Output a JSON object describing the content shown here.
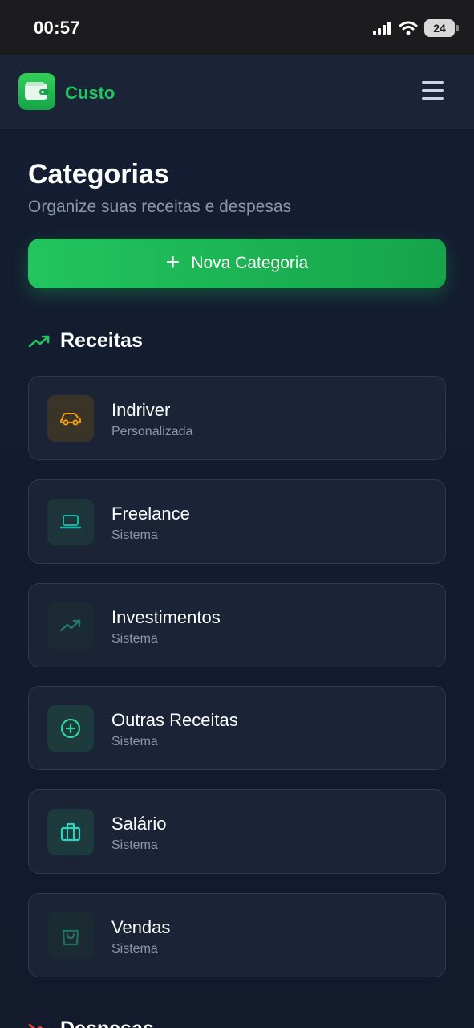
{
  "status_bar": {
    "time": "00:57",
    "battery": "24",
    "icons": [
      "signal-icon",
      "wifi-icon",
      "battery-icon"
    ]
  },
  "header": {
    "brand": "Custo",
    "logo_icon": "wallet-icon",
    "menu_icon": "hamburger-menu-icon"
  },
  "page": {
    "title": "Categorias",
    "subtitle": "Organize suas receitas e despesas",
    "new_button_label": "Nova Categoria"
  },
  "colors": {
    "accent_green": "#22c55e",
    "income_trend": "#22c55e",
    "expense_trend": "#ef4444",
    "car_orange": "#f59e0b"
  },
  "sections": {
    "income": {
      "title": "Receitas",
      "icon": "trending-up-icon",
      "items": [
        {
          "name": "Indriver",
          "type": "Personalizada",
          "icon": "car-icon"
        },
        {
          "name": "Freelance",
          "type": "Sistema",
          "icon": "laptop-icon"
        },
        {
          "name": "Investimentos",
          "type": "Sistema",
          "icon": "trending-up-icon"
        },
        {
          "name": "Outras Receitas",
          "type": "Sistema",
          "icon": "plus-circle-icon"
        },
        {
          "name": "Salário",
          "type": "Sistema",
          "icon": "briefcase-icon"
        },
        {
          "name": "Vendas",
          "type": "Sistema",
          "icon": "shopping-bag-icon"
        }
      ]
    },
    "expenses": {
      "title": "Despesas",
      "icon": "trending-down-icon"
    }
  }
}
